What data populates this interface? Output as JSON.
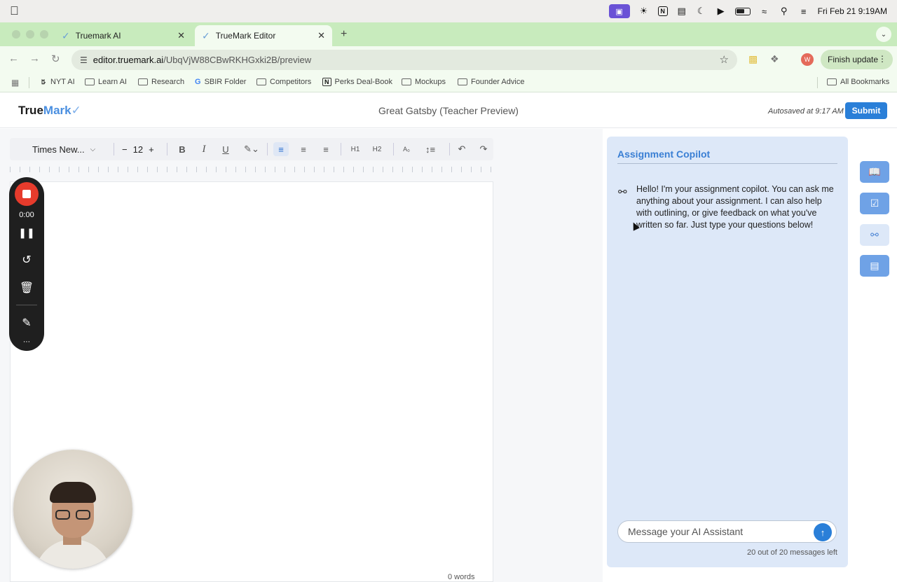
{
  "menubar": {
    "clock": "Fri Feb 21  9:19AM",
    "icons": [
      "apple-icon",
      "screen-share-icon",
      "brightness-icon",
      "notion-icon",
      "keyboard-icon",
      "moon-icon",
      "play-icon",
      "battery-icon",
      "wifi-icon",
      "search-icon",
      "control-center-icon"
    ]
  },
  "browser": {
    "tabs": [
      {
        "label": "Truemark AI",
        "active": false
      },
      {
        "label": "TrueMark Editor",
        "active": true
      }
    ],
    "url_host": "editor.truemark.ai",
    "url_path": "/UbqVjW88CBwRKHGxki2B/preview",
    "profile_initial": "W",
    "finish_update_label": "Finish update",
    "bookmarks": [
      "NYT AI",
      "Learn AI",
      "Research",
      "SBIR Folder",
      "Competitors",
      "Perks Deal-Book",
      "Mockups",
      "Founder Advice"
    ],
    "all_bookmarks_label": "All Bookmarks"
  },
  "app": {
    "brand_true": "True",
    "brand_mark": "Mark",
    "document_title": "Great Gatsby (Teacher Preview)",
    "autosave_text": "Autosaved at 9:17 AM",
    "submit_label": "Submit"
  },
  "toolbar": {
    "font_family": "Times New...",
    "font_size": "12",
    "h1_label": "H1",
    "h2_label": "H2"
  },
  "editor": {
    "word_count": "0 words"
  },
  "recorder": {
    "time": "0:00"
  },
  "copilot": {
    "title": "Assignment Copilot",
    "message": "Hello! I'm your assignment copilot. You can ask me anything about your assignment. I can also help with outlining, or give feedback on what you've written so far. Just type your questions below!",
    "input_placeholder": "Message your AI Assistant",
    "messages_left": "20 out of 20 messages left"
  },
  "colors": {
    "accent": "#2a7fd8",
    "copilot_bg": "#dde8f8",
    "tab_strip": "#c8ebbd",
    "record_red": "#e63b2c"
  }
}
